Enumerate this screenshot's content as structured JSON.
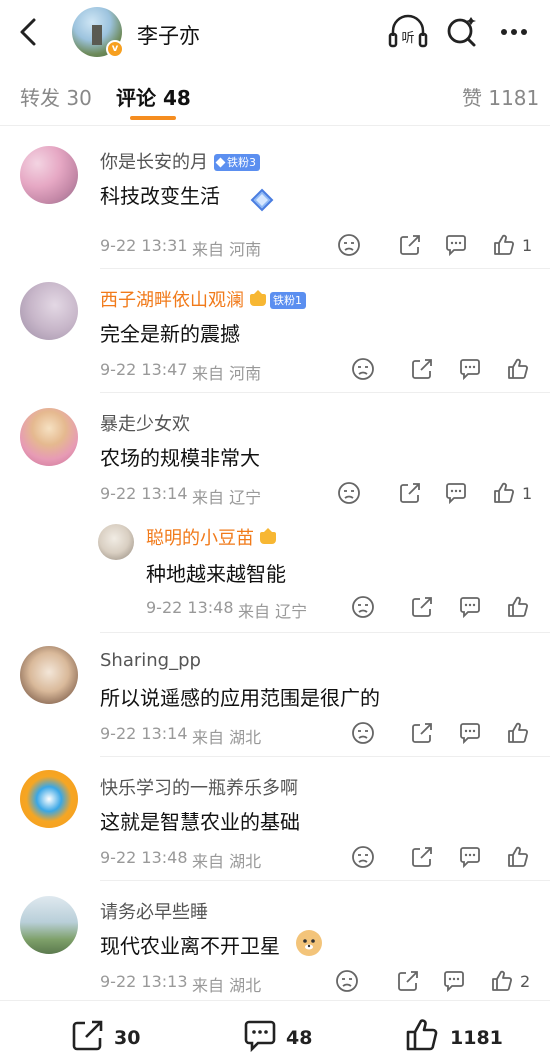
{
  "header": {
    "user_name": "李子亦",
    "verified_icon": "v-icon",
    "listen_label": "听",
    "icons": [
      "back-arrow-icon",
      "headphone-icon",
      "search-icon",
      "more-icon"
    ]
  },
  "tabs": {
    "repost": "转发 30",
    "comment": "评论 48",
    "like": "赞 1181"
  },
  "comments": [
    {
      "name": "你是长安的月",
      "badge": "铁粉3",
      "text": "科技改变生活",
      "time": "9-22 13:31",
      "location": "来自 河南",
      "like_count": "1"
    },
    {
      "name": "西子湖畔依山观澜",
      "badge": "铁粉1",
      "text": "完全是新的震撼",
      "time": "9-22 13:47",
      "location": "来自 河南",
      "like_count": ""
    },
    {
      "name": "暴走少女欢",
      "badge": "",
      "text": "农场的规模非常大",
      "time": "9-22 13:14",
      "location": "来自 辽宁",
      "like_count": "1"
    },
    {
      "name": "聪明的小豆苗",
      "badge": "",
      "text": "种地越来越智能",
      "time": "9-22 13:48",
      "location": "来自 辽宁",
      "like_count": ""
    },
    {
      "name": "Sharing_pp",
      "badge": "",
      "text": "所以说遥感的应用范围是很广的",
      "time": "9-22 13:14",
      "location": "来自 湖北",
      "like_count": ""
    },
    {
      "name": "快乐学习的一瓶养乐多啊",
      "badge": "",
      "text": "这就是智慧农业的基础",
      "time": "9-22 13:48",
      "location": "来自 湖北",
      "like_count": ""
    },
    {
      "name": "请务必早些睡",
      "badge": "",
      "text": "现代农业离不开卫星",
      "time": "9-22 13:13",
      "location": "来自 湖北",
      "like_count": "2"
    }
  ],
  "footer": {
    "repost_count": "30",
    "comment_count": "48",
    "like_count": "1181"
  },
  "colors": {
    "accent": "#f58d20",
    "name_orange": "#f17a1a",
    "badge_blue": "#5b8ff0"
  }
}
